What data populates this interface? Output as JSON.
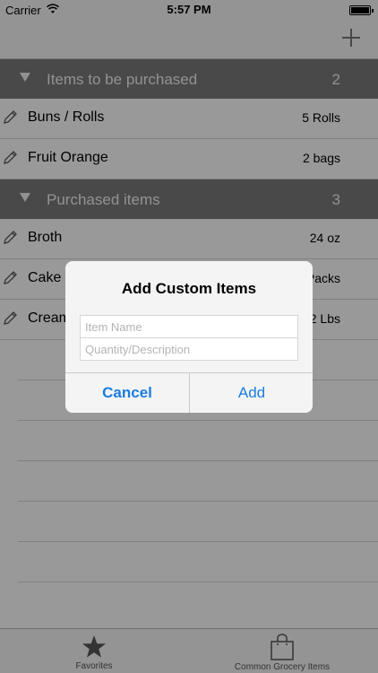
{
  "status_bar": {
    "carrier": "Carrier",
    "time": "5:57 PM"
  },
  "nav": {
    "add_icon": "plus-icon"
  },
  "sections": [
    {
      "title": "Items to be purchased",
      "count": "2",
      "items": [
        {
          "name": "Buns / Rolls",
          "qty": "5 Rolls"
        },
        {
          "name": "Fruit Orange",
          "qty": "2 bags"
        }
      ]
    },
    {
      "title": "Purchased items",
      "count": "3",
      "items": [
        {
          "name": "Broth",
          "qty": "24 oz"
        },
        {
          "name": "Cake ",
          "qty": "Packs"
        },
        {
          "name": "Cream",
          "qty": "2 Lbs"
        }
      ]
    }
  ],
  "tabs": [
    {
      "label": "Favorites",
      "icon": "star-icon"
    },
    {
      "label": "Common Grocery Items",
      "icon": "shopping-bag-icon"
    }
  ],
  "dialog": {
    "title": "Add Custom Items",
    "name_placeholder": "Item Name",
    "qty_placeholder": "Quantity/Description",
    "cancel_label": "Cancel",
    "add_label": "Add"
  },
  "colors": {
    "section_header": "#7b7b7b",
    "button_blue": "#1a7de0",
    "overlay": "rgba(0,0,0,0.40)"
  }
}
